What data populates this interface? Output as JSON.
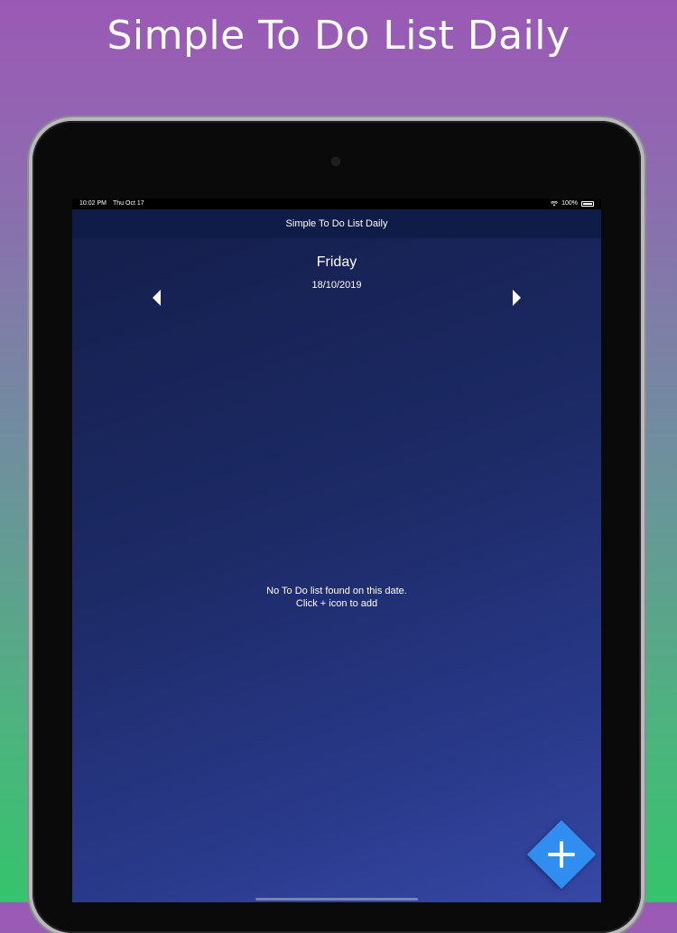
{
  "promo": {
    "title": "Simple To Do List Daily"
  },
  "status_bar": {
    "time": "10:02 PM",
    "date": "Thu Oct 17",
    "battery": "100%"
  },
  "nav": {
    "title": "Simple To Do List Daily"
  },
  "date_selector": {
    "day_name": "Friday",
    "date": "18/10/2019",
    "prev_icon": "triangle-left-icon",
    "next_icon": "triangle-right-icon"
  },
  "empty_state": {
    "line1": "No To Do list found on this date.",
    "line2": "Click + icon to add"
  },
  "fab": {
    "icon": "plus-icon",
    "color": "#2f8ef0"
  },
  "colors": {
    "nav_bg": "#0f1c48",
    "screen_bg_top": "#141e4a",
    "screen_bg_bottom": "#3648a6",
    "promo_gradient_top": "#9b59b6",
    "promo_gradient_bottom": "#35c46d"
  }
}
